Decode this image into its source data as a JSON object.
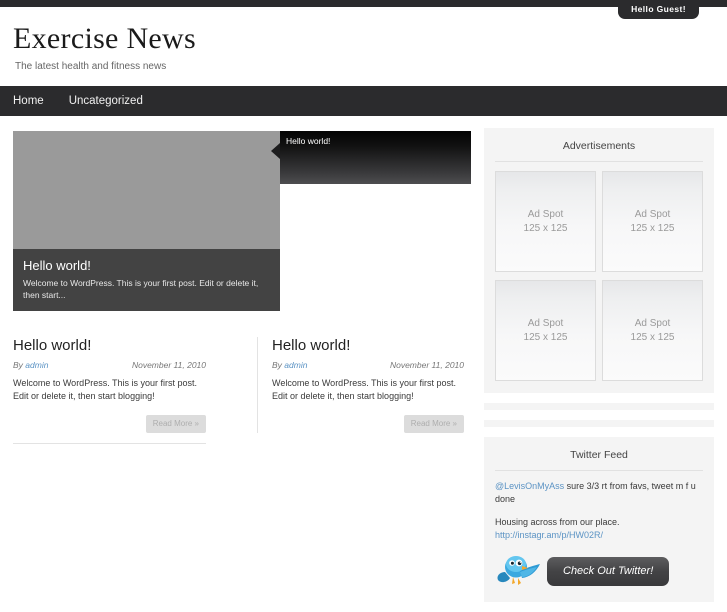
{
  "topbar": {
    "guest_label": "Hello Guest!"
  },
  "header": {
    "title": "Exercise News",
    "tagline": "The latest health and fitness news"
  },
  "nav": {
    "items": [
      {
        "label": "Home"
      },
      {
        "label": "Uncategorized"
      }
    ]
  },
  "slider": {
    "caption_title": "Hello world!",
    "caption_text": "Welcome to WordPress. This is your first post. Edit or delete it, then start...",
    "tabs": [
      {
        "label": "Hello world!"
      }
    ]
  },
  "posts": [
    {
      "title": "Hello world!",
      "by_label": "By",
      "author": "admin",
      "date": "November 11, 2010",
      "excerpt": "Welcome to WordPress. This is your first post. Edit or delete it, then start blogging!",
      "read_more": "Read More »"
    },
    {
      "title": "Hello world!",
      "by_label": "By",
      "author": "admin",
      "date": "November 11, 2010",
      "excerpt": "Welcome to WordPress. This is your first post. Edit or delete it, then start blogging!",
      "read_more": "Read More »"
    }
  ],
  "sidebar": {
    "ads_widget": {
      "title": "Advertisements",
      "spots": [
        {
          "line1": "Ad Spot",
          "line2": "125 x 125"
        },
        {
          "line1": "Ad Spot",
          "line2": "125 x 125"
        },
        {
          "line1": "Ad Spot",
          "line2": "125 x 125"
        },
        {
          "line1": "Ad Spot",
          "line2": "125 x 125"
        }
      ]
    },
    "twitter_widget": {
      "title": "Twitter Feed",
      "tweets": [
        {
          "handle": "@LevisOnMyAss",
          "text": " sure 3/3 rt from favs, tweet m f u done",
          "link": ""
        },
        {
          "handle": "",
          "text": "Housing across from our place. ",
          "link": "http://instagr.am/p/HW02R/"
        }
      ],
      "button_label": "Check Out Twitter!"
    }
  },
  "colors": {
    "dark": "#2b2b2d",
    "link": "#5b93c4",
    "widget_bg": "#f4f4f4",
    "bird_blue": "#3ba9e0"
  }
}
